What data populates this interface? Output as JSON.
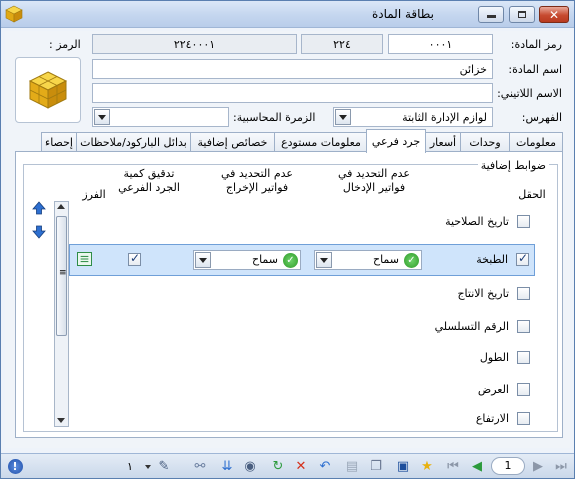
{
  "window": {
    "title": "بطاقة المادة",
    "app_icon": "cube-icon",
    "buttons": [
      "minimize-icon",
      "restore-icon",
      "close-icon"
    ]
  },
  "header": {
    "code_label": "الرمز :",
    "barcode_value": "٢٢٤٠٠٠١",
    "code_short_value": "٢٢٤",
    "material_code_label": "رمز المادة:",
    "material_code_value": "٠٠٠١",
    "material_name_label": "اسم المادة:",
    "material_name_value": "خزائن",
    "latin_name_label": "الاسم اللاتيني:",
    "latin_name_value": "",
    "index_label": "الفهرس:",
    "index_value": "لوازم الإدارة الثابتة",
    "acct_group_label": "الزمرة المحاسبية:",
    "acct_group_value": ""
  },
  "tabs": [
    {
      "label": "معلومات"
    },
    {
      "label": "وحدات"
    },
    {
      "label": "أسعار"
    },
    {
      "label": "جرد فرعي",
      "active": true
    },
    {
      "label": "معلومات مستودع"
    },
    {
      "label": "خصائص إضافية"
    },
    {
      "label": "بدائل الباركود/ملاحظات"
    },
    {
      "label": "إحصاء"
    }
  ],
  "panel": {
    "group_title": "ضوابط إضافية",
    "headers": {
      "field": "الحقل",
      "no_input": "عدم التحديد في\nفواتير الإدخال",
      "no_output": "عدم التحديد في\nفواتير الإخراج",
      "check_qty": "تدقيق كمية\nالجرد الفرعي",
      "sort": "الفرز"
    },
    "rows": [
      {
        "label": "تاريخ الصلاحية",
        "checked": false
      },
      {
        "label": "الطبخة",
        "checked": true,
        "input_value": "سماح",
        "output_value": "سماح",
        "check_qty": true
      },
      {
        "label": "تاريخ الانتاج",
        "checked": false
      },
      {
        "label": "الرقم التسلسلي",
        "checked": false
      },
      {
        "label": "الطول",
        "checked": false
      },
      {
        "label": "العرض",
        "checked": false
      },
      {
        "label": "الارتفاع",
        "checked": false
      }
    ]
  },
  "statusbar": {
    "count": "١",
    "page": "1",
    "icons": [
      "help-icon",
      "attach-icon",
      "binoculars-icon",
      "sort-icon",
      "eye-icon",
      "refresh-icon",
      "delete-icon",
      "undo-icon",
      "paste-icon",
      "copy-icon",
      "save-icon",
      "star-icon",
      "first-icon",
      "prev-icon",
      "next-icon",
      "last-icon"
    ]
  },
  "colors": {
    "accent": "#2d6fd0",
    "selection": "#cfe4fb",
    "title_bg": "#c4d6ef"
  }
}
